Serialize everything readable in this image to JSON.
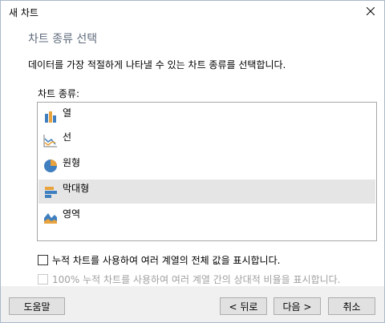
{
  "window": {
    "title": "새 차트"
  },
  "header": {
    "title": "차트 종류 선택"
  },
  "description": "데이터를 가장 적절하게 나타낼 수 있는 차트 종류를 선택합니다.",
  "chart_types": {
    "label": "차트 종류:",
    "items": [
      {
        "label": "열",
        "icon": "column-chart-icon"
      },
      {
        "label": "선",
        "icon": "line-chart-icon"
      },
      {
        "label": "원형",
        "icon": "pie-chart-icon"
      },
      {
        "label": "막대형",
        "icon": "bar-chart-icon",
        "selected": true
      },
      {
        "label": "영역",
        "icon": "area-chart-icon"
      }
    ]
  },
  "options": {
    "stacked": {
      "label": "누적 차트를 사용하여 여러 계열의 전체 값을 표시합니다.",
      "checked": false,
      "enabled": true
    },
    "stacked100": {
      "label": "100% 누적 차트를 사용하여 여러 계열 간의 상대적 비율을 표시합니다.",
      "checked": false,
      "enabled": false
    }
  },
  "buttons": {
    "help": "도움말",
    "back": "< 뒤로",
    "next": "다음 >",
    "cancel": "취소"
  },
  "colors": {
    "blue": "#3f7fbf",
    "orange": "#e8a33d",
    "selection": "#e5e5e5"
  }
}
